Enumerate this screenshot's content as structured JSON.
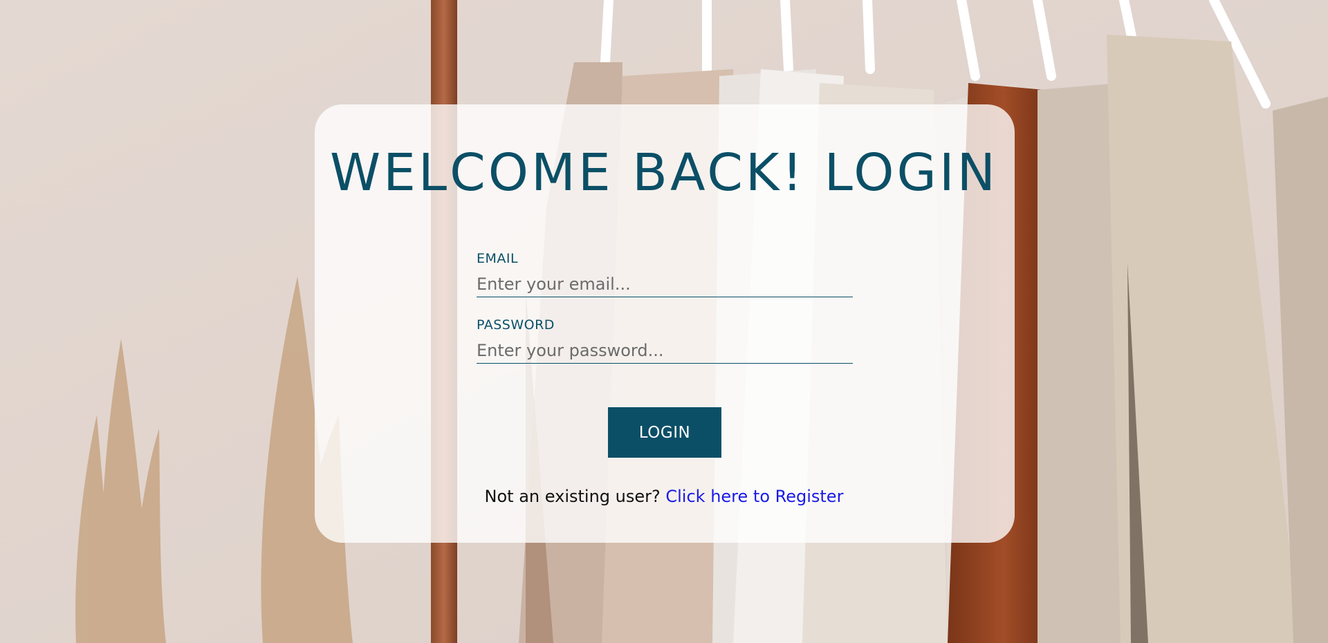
{
  "login": {
    "title": "WELCOME BACK! LOGIN",
    "email": {
      "label": "EMAIL",
      "placeholder": "Enter your email..."
    },
    "password": {
      "label": "PASSWORD",
      "placeholder": "Enter your password..."
    },
    "submit_label": "LOGIN",
    "register_prompt": "Not an existing user?",
    "register_link": "Click here to Register"
  },
  "colors": {
    "accent": "#0b4f66",
    "link": "#1a1ae6",
    "card_background": "rgba(255,255,255,0.78)"
  },
  "background": {
    "image": "clothing-rack-photo"
  }
}
